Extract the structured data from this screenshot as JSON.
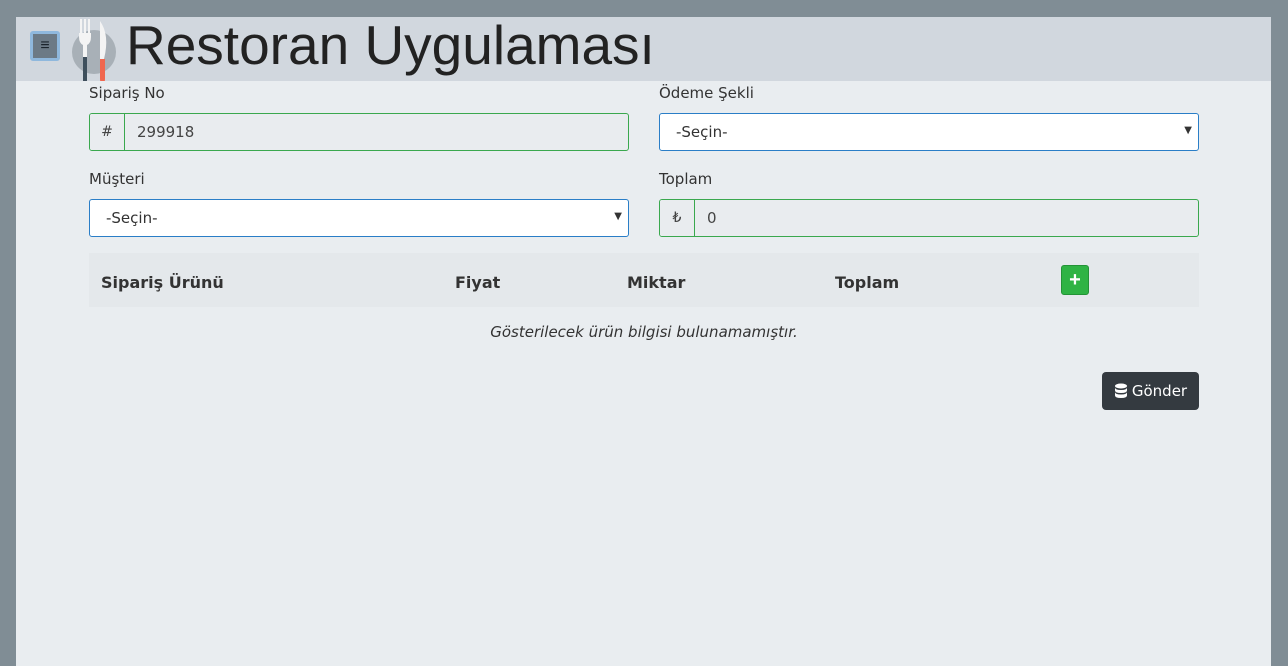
{
  "header": {
    "title": "Restoran Uygulaması",
    "menu_icon": "hamburger-icon",
    "logo_icon": "fork-knife-icon"
  },
  "form": {
    "order_no": {
      "label": "Sipariş No",
      "prefix": "#",
      "value": "299918"
    },
    "payment": {
      "label": "Ödeme Şekli",
      "selected": "-Seçin-"
    },
    "customer": {
      "label": "Müşteri",
      "selected": "-Seçin-"
    },
    "total": {
      "label": "Toplam",
      "prefix": "₺",
      "value": "0"
    }
  },
  "table": {
    "columns": [
      "Sipariş Ürünü",
      "Fiyat",
      "Miktar",
      "Toplam"
    ],
    "add_icon": "plus-icon",
    "empty_message": "Gösterilecek ürün bilgisi bulunamamıştır."
  },
  "actions": {
    "send_label": "Gönder",
    "send_icon": "database-icon"
  },
  "colors": {
    "readonly_border": "#3aa84e",
    "select_border": "#2a7ec7",
    "add_button": "#2fb344",
    "send_button": "#343a40",
    "knife_tip": "#f0674f"
  }
}
